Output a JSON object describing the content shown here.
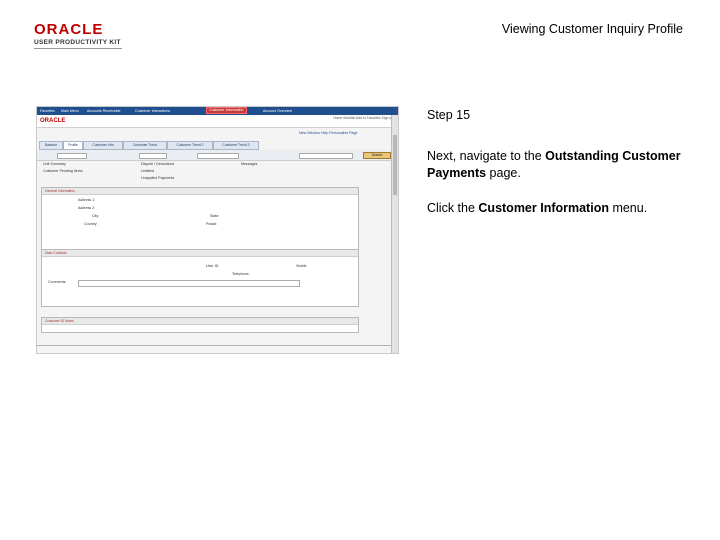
{
  "header": {
    "logo_main": "ORACLE",
    "logo_sub": "USER PRODUCTIVITY KIT",
    "title": "Viewing Customer Inquiry Profile"
  },
  "step": {
    "label": "Step 15",
    "line1_pre": "Next, navigate to the ",
    "line1_bold": "Outstanding Customer Payments",
    "line1_post": " page.",
    "line2_pre": "Click the ",
    "line2_bold": "Customer Information",
    "line2_post": " menu."
  },
  "screenshot": {
    "menu_items": [
      "Favorites",
      "Main Menu",
      "Accounts Receivable",
      "Customer Interactions",
      "Customer Information",
      "Account Overview"
    ],
    "highlighted_menu": "Customer Information",
    "brand": "ORACLE",
    "header_links": "Home  Worklist  Add to Favorites  Sign out",
    "header_links2": "New Window  Help  Personalize Page",
    "tabs": [
      "Balance",
      "Profile",
      "Customer Info",
      "Customer Trend",
      "Customer Trend 2",
      "Customer Trend 3"
    ],
    "active_tab": "Profile",
    "search_button": "Search",
    "sections": {
      "general": "General Information",
      "contacts": "Main Contacts",
      "notes": "Customer ID Notes"
    },
    "labels": {
      "address": "Address 1:",
      "address2": "Address 2:",
      "city": "City:",
      "country": "Country:",
      "state": "State:",
      "postal": "Postal:",
      "comments": "Comments:",
      "visible": "Visible",
      "unbilled": "Unbilled",
      "messages": "Messages",
      "user_id": "User ID:",
      "telephone": "Telephone:"
    }
  }
}
